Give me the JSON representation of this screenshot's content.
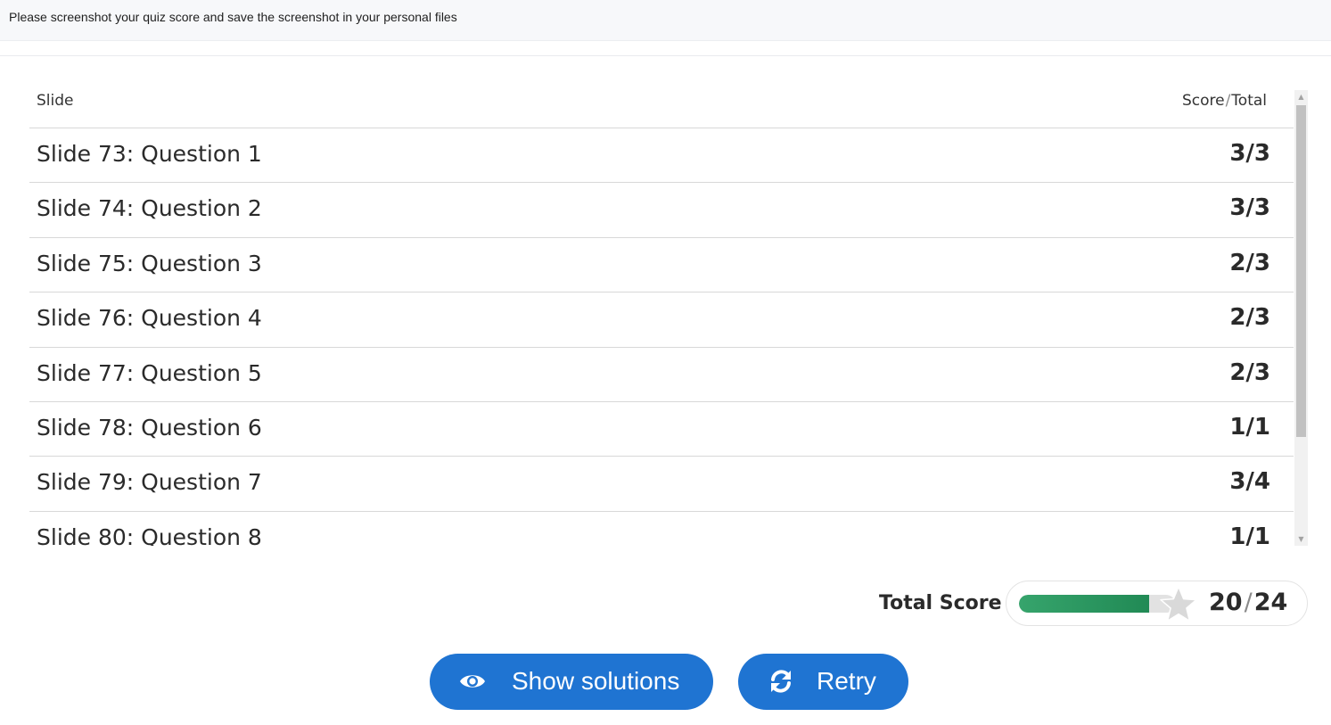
{
  "notice": {
    "text": "Please screenshot your quiz score and save the screenshot in your personal files"
  },
  "table": {
    "header_slide": "Slide",
    "header_score": "Score",
    "header_separator": "/",
    "header_total": "Total",
    "rows": [
      {
        "label": "Slide 73: Question 1",
        "score": "3/3"
      },
      {
        "label": "Slide 74: Question 2",
        "score": "3/3"
      },
      {
        "label": "Slide 75: Question 3",
        "score": "2/3"
      },
      {
        "label": "Slide 76: Question 4",
        "score": "2/3"
      },
      {
        "label": "Slide 77: Question 5",
        "score": "2/3"
      },
      {
        "label": "Slide 78: Question 6",
        "score": "1/1"
      },
      {
        "label": "Slide 79: Question 7",
        "score": "3/4"
      },
      {
        "label": "Slide 80: Question 8",
        "score": "1/1"
      }
    ]
  },
  "total": {
    "label": "Total Score",
    "score": "20",
    "separator": "/",
    "max": "24",
    "progress_fraction": 0.833
  },
  "buttons": {
    "show_solutions": "Show solutions",
    "retry": "Retry"
  },
  "icons": {
    "show_solutions": "eye-icon",
    "retry": "refresh-icon",
    "score": "star-icon"
  },
  "colors": {
    "button": "#1f74d2",
    "progress": "#2a9a62",
    "star": "#d9d9d9"
  }
}
